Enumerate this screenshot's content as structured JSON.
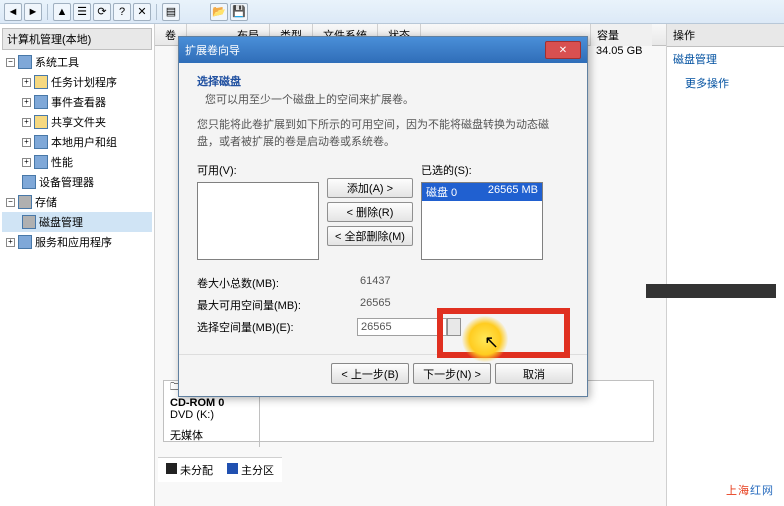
{
  "toolbar_icons": [
    "back",
    "fwd",
    "up",
    "props",
    "refresh",
    "help",
    "x",
    "list",
    "open",
    "save"
  ],
  "tree": {
    "root": "计算机管理(本地)",
    "n1": "系统工具",
    "n1a": "任务计划程序",
    "n1b": "事件查看器",
    "n1c": "共享文件夹",
    "n1d": "本地用户和组",
    "n1e": "性能",
    "n1f": "设备管理器",
    "n2": "存储",
    "n2a": "磁盘管理",
    "n3": "服务和应用程序"
  },
  "cols": {
    "c1": "卷",
    "c2": "布局",
    "c3": "类型",
    "c4": "文件系统",
    "c5": "状态",
    "c6": "容量"
  },
  "capacity": "34.05 GB",
  "actions": {
    "hdr": "操作",
    "a1": "磁盘管理",
    "a2": "更多操作"
  },
  "dialog": {
    "title": "扩展卷向导",
    "close": "✕",
    "heading": "选择磁盘",
    "sub": "您可以用至少一个磁盘上的空间来扩展卷。",
    "desc": "您只能将此卷扩展到如下所示的可用空间，因为不能将磁盘转换为动态磁盘，或者被扩展的卷是启动卷或系统卷。",
    "avail_lbl": "可用(V):",
    "selected_lbl": "已选的(S):",
    "sel_item_name": "磁盘 0",
    "sel_item_val": "26565 MB",
    "btn_add": "添加(A) >",
    "btn_remove": "< 删除(R)",
    "btn_remove_all": "< 全部删除(M)",
    "row1_lbl": "卷大小总数(MB):",
    "row1_val": "61437",
    "row2_lbl": "最大可用空间量(MB):",
    "row2_val": "26565",
    "row3_lbl": "选择空间量(MB)(E):",
    "row3_val": "26565",
    "btn_back": "< 上一步(B)",
    "btn_next": "下一步(N) >",
    "btn_cancel": "取消"
  },
  "disk": {
    "cd": "CD-ROM 0",
    "dvd": "DVD (K:)",
    "empty": "无媒体"
  },
  "legend": {
    "a": "未分配",
    "b": "主分区"
  },
  "watermark": "上海红网"
}
